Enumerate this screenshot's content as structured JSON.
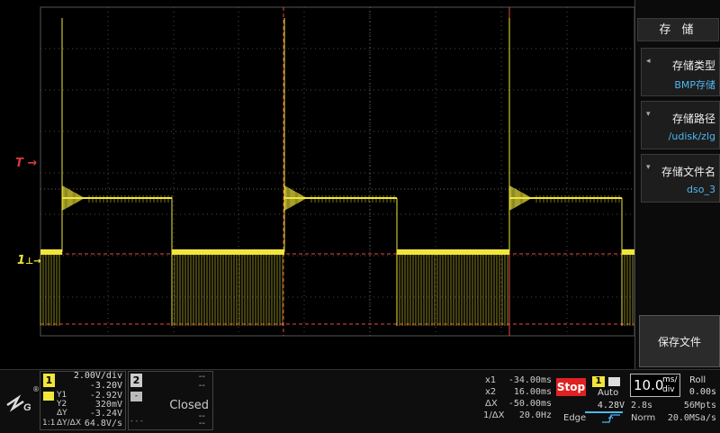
{
  "markers": {
    "trigger": "T",
    "channel1": "1"
  },
  "panel": {
    "title": "存 储",
    "items": [
      {
        "label": "存储类型",
        "value": "BMP存储",
        "arrow": "◂"
      },
      {
        "label": "存储路径",
        "value": "/udisk/zlg",
        "arrow": "▾"
      },
      {
        "label": "存储文件名",
        "value": "dso_3",
        "arrow": "▾"
      }
    ],
    "save_label": "保存文件"
  },
  "logo": {
    "text": "ZLG",
    "mark": "®"
  },
  "ch1": {
    "number": "1",
    "scale": "2.00V/div",
    "offset": "-3.20V",
    "y1_label": "Y1",
    "y1_value": "-2.92V",
    "y2_label": "Y2",
    "y2_value": "320mV",
    "dy_label": "ΔY",
    "dy_value": "-3.24V",
    "ratio_label": "1:1",
    "dydx_label": "ΔY/ΔX",
    "dydx_value": "64.8V/s"
  },
  "ch2": {
    "number": "2",
    "dash1": "--",
    "dash2": "--",
    "minus": "-",
    "status": "Closed",
    "dash3": "--",
    "dash4": "--",
    "dots": "- - -"
  },
  "cursors": {
    "x1_label": "x1",
    "x1_value": "-34.00ms",
    "x2_label": "x2",
    "x2_value": "16.00ms",
    "dx_label": "ΔX",
    "dx_value": "-50.00ms",
    "inv_label": "1/ΔX",
    "inv_value": "20.0Hz"
  },
  "trigger": {
    "run_state": "Stop",
    "source": "1",
    "mode": "Auto",
    "level": "4.28V",
    "type": "Edge"
  },
  "timebase": {
    "value": "10.0",
    "unit_top": "ms/",
    "unit_bot": "div",
    "roll": "Roll",
    "delay": "0.00s",
    "memory_time": "2.8s",
    "memory_depth": "56Mpts",
    "acq_mode": "Norm",
    "sample_rate": "20.0MSa/s"
  },
  "colors": {
    "ch1": "#f0e63c",
    "trigger_ref": "#e54b3c",
    "stop": "#e02121",
    "accent": "#4fb6f0"
  }
}
